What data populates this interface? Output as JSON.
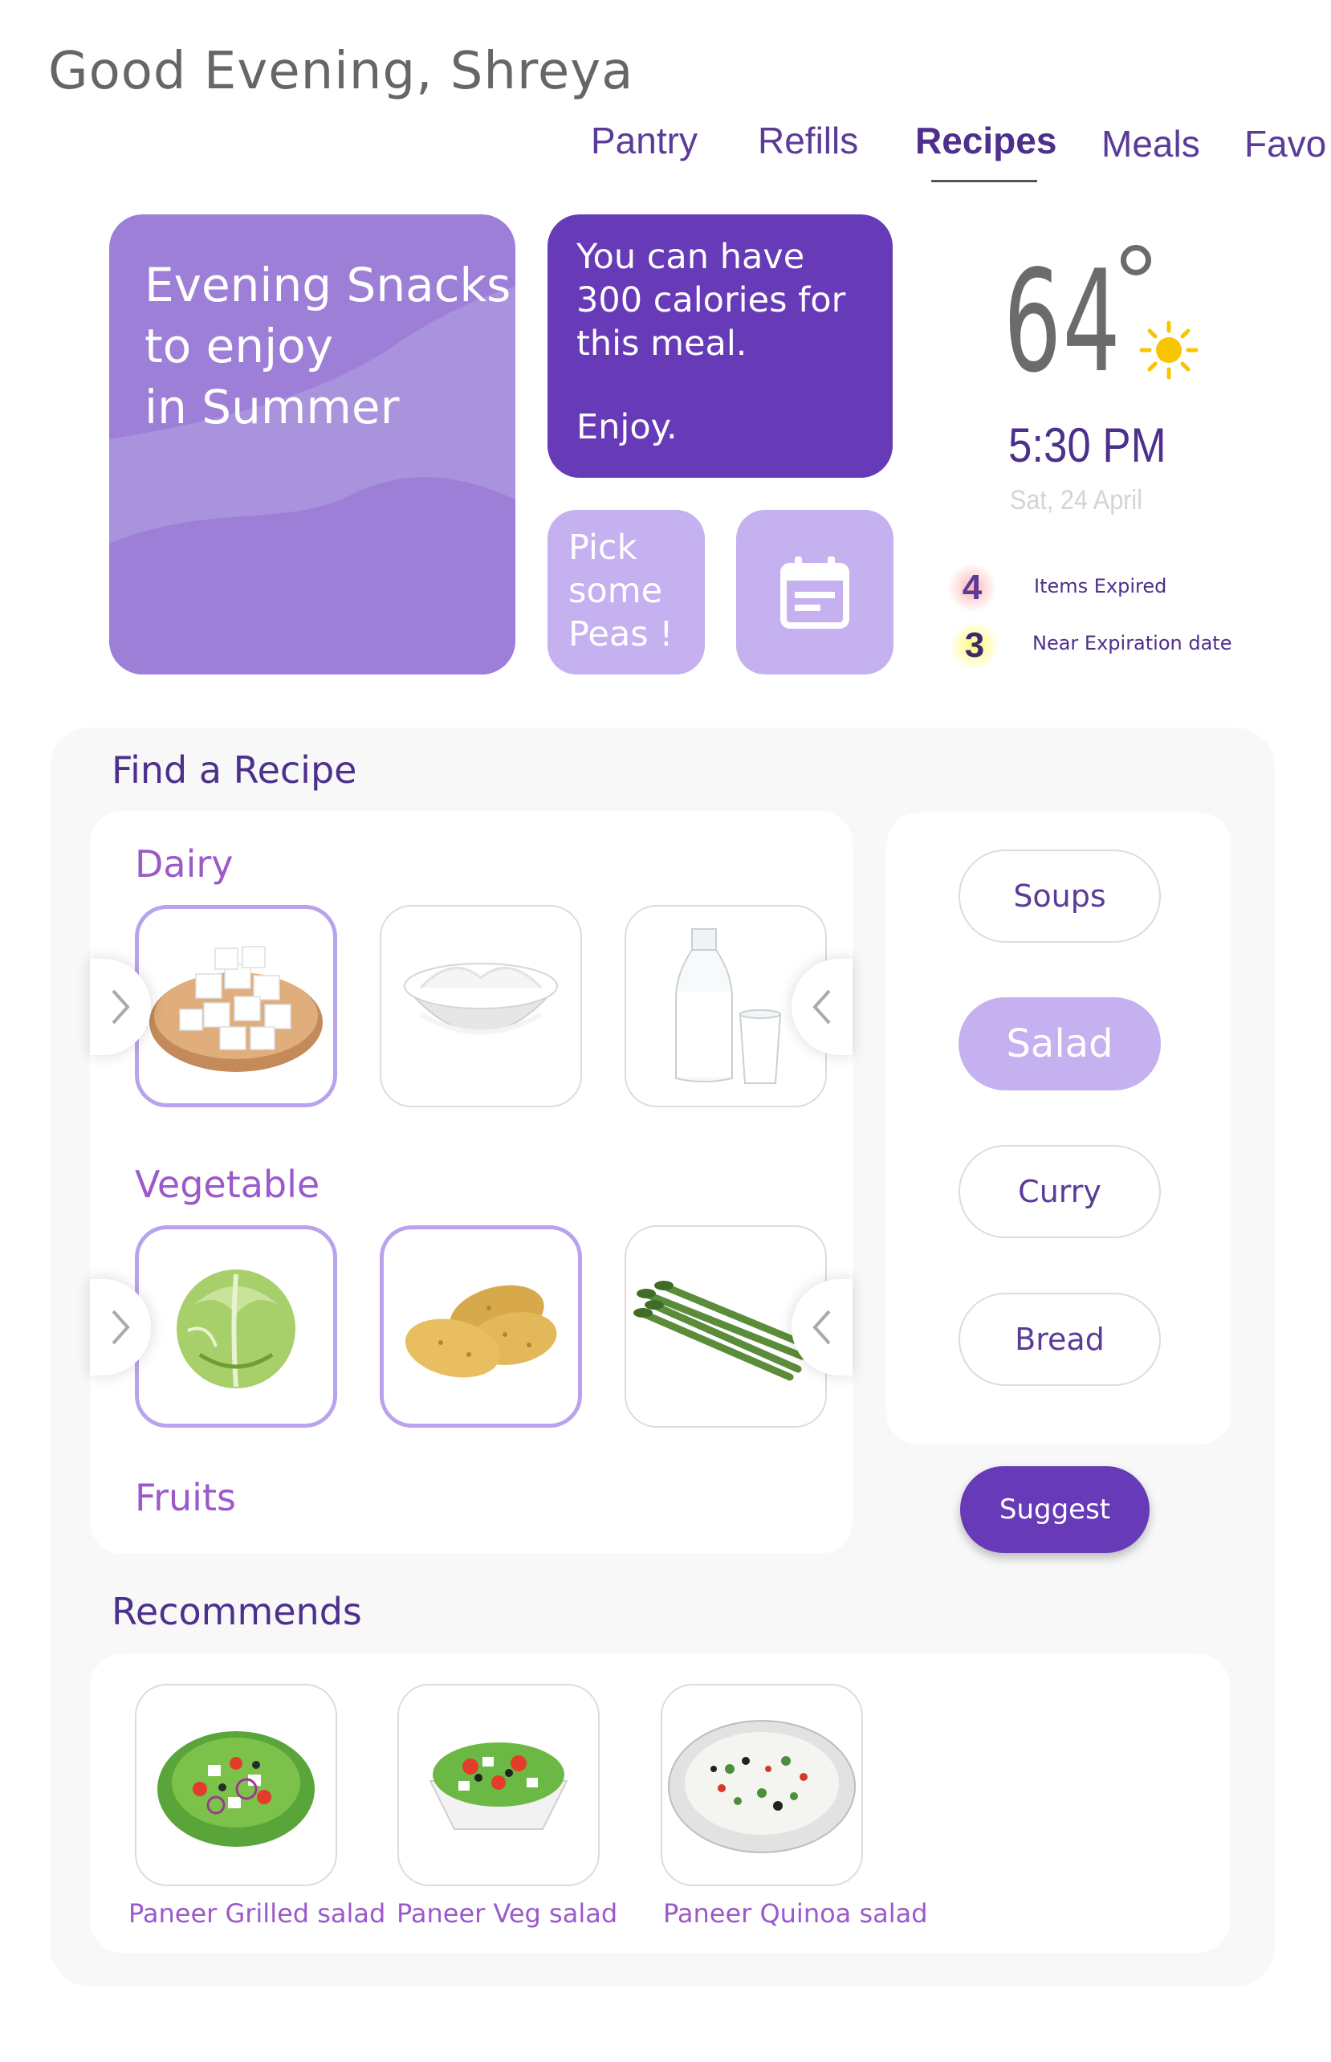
{
  "greeting": "Good Evening, Shreya",
  "nav": {
    "tabs": [
      {
        "label": "Pantry"
      },
      {
        "label": "Refills"
      },
      {
        "label": "Recipes",
        "active": true
      },
      {
        "label": "Meals"
      },
      {
        "label": "Favo"
      }
    ]
  },
  "promo": {
    "line1": "Evening Snacks",
    "line2": "to enjoy",
    "line3": "in Summer"
  },
  "calories": {
    "line1": "You can have",
    "line2": "300 calories for",
    "line3": "this meal.",
    "enjoy": "Enjoy."
  },
  "tip": {
    "line1": "Pick",
    "line2": "some",
    "line3": "Peas !"
  },
  "weather": {
    "temperature": "64",
    "time": "5:30 PM",
    "date": "Sat, 24 April",
    "icon": "sun-icon"
  },
  "stats": {
    "expired_count": "4",
    "expired_label": "Items Expired",
    "near_count": "3",
    "near_label": "Near Expiration date"
  },
  "find": {
    "title": "Find a Recipe",
    "categories": [
      {
        "label": "Dairy",
        "items": [
          "paneer",
          "curd",
          "milk"
        ]
      },
      {
        "label": "Vegetable",
        "items": [
          "cabbage",
          "potato",
          "asparagus"
        ]
      },
      {
        "label": "Fruits"
      }
    ]
  },
  "filters": [
    {
      "label": "Soups",
      "selected": false
    },
    {
      "label": "Salad",
      "selected": true
    },
    {
      "label": "Curry",
      "selected": false
    },
    {
      "label": "Bread",
      "selected": false
    }
  ],
  "suggest_label": "Suggest",
  "recommends": {
    "title": "Recommends",
    "items": [
      {
        "label": "Paneer Grilled salad"
      },
      {
        "label": "Paneer Veg salad"
      },
      {
        "label": "Paneer Quinoa salad"
      }
    ]
  },
  "colors": {
    "accent": "#673ab7",
    "light_accent": "#c5b0f0",
    "category_text": "#9b59c9"
  }
}
